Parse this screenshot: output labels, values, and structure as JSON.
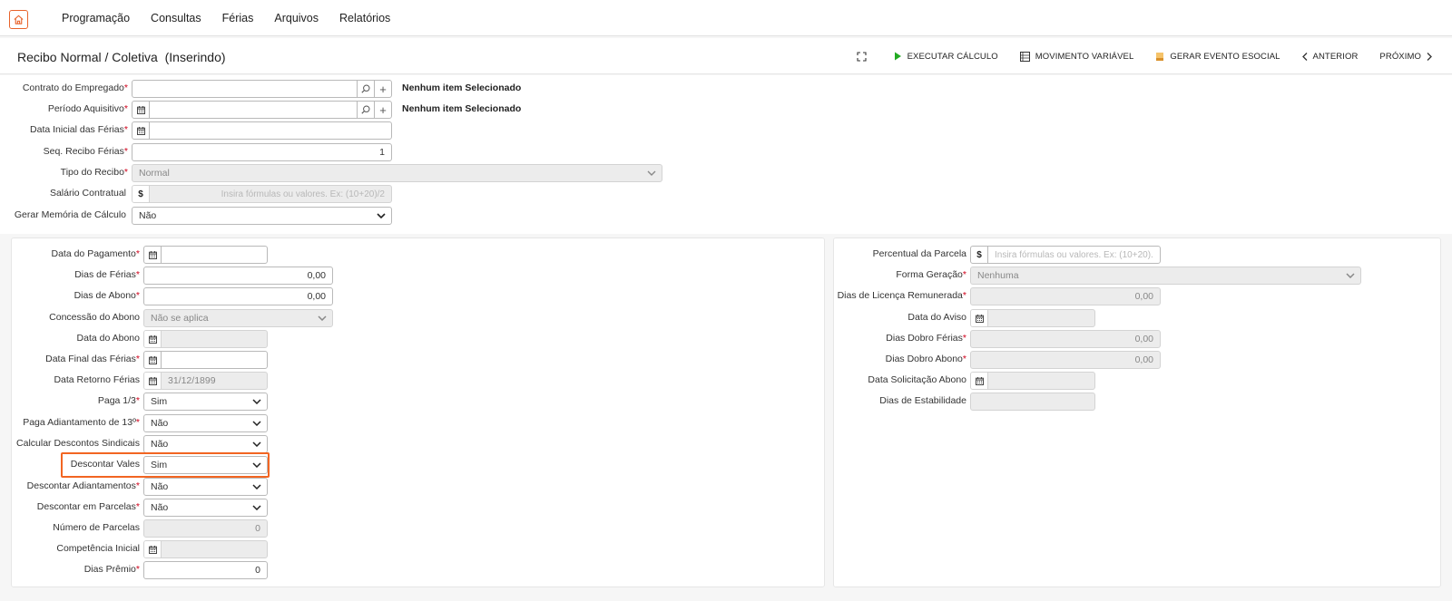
{
  "nav": {
    "home_icon": "home-icon",
    "items": [
      "Programação",
      "Consultas",
      "Férias",
      "Arquivos",
      "Relatórios"
    ]
  },
  "header": {
    "title": "Recibo Normal / Coletiva  (Inserindo)",
    "toolbar": {
      "execute": "EXECUTAR CÁLCULO",
      "movement": "MOVIMENTO VARIÁVEL",
      "esocial": "GERAR EVENTO ESOCIAL",
      "previous": "ANTERIOR",
      "next": "PRÓXIMO"
    }
  },
  "top_form": {
    "contrato": {
      "label": "Contrato do Empregado",
      "value": "",
      "info": "Nenhum item Selecionado"
    },
    "periodo": {
      "label": "Período Aquisitivo",
      "value": "",
      "info": "Nenhum item Selecionado"
    },
    "data_inicial": {
      "label": "Data Inicial das Férias",
      "value": ""
    },
    "seq_recibo": {
      "label": "Seq. Recibo Férias",
      "value": "1"
    },
    "tipo_recibo": {
      "label": "Tipo do Recibo",
      "value": "Normal"
    },
    "salario": {
      "label": "Salário Contratual",
      "placeholder": "Insira fórmulas ou valores. Ex: (10+20)/2"
    },
    "memoria": {
      "label": "Gerar Memória de Cálculo",
      "value": "Não"
    }
  },
  "left_panel": {
    "data_pagamento": {
      "label": "Data do Pagamento",
      "value": ""
    },
    "dias_ferias": {
      "label": "Dias de Férias",
      "value": "0,00"
    },
    "dias_abono": {
      "label": "Dias de Abono",
      "value": "0,00"
    },
    "concessao_abono": {
      "label": "Concessão do Abono",
      "value": "Não se aplica"
    },
    "data_abono": {
      "label": "Data do Abono",
      "value": ""
    },
    "data_final": {
      "label": "Data Final das Férias",
      "value": ""
    },
    "data_retorno": {
      "label": "Data Retorno Férias",
      "value": "31/12/1899"
    },
    "paga_terco": {
      "label": "Paga 1/3",
      "value": "Sim"
    },
    "paga_adiant": {
      "label": "Paga Adiantamento de 13º",
      "value": "Não"
    },
    "calc_sindicais": {
      "label": "Calcular Descontos Sindicais",
      "value": "Não"
    },
    "descontar_vales": {
      "label": "Descontar Vales",
      "value": "Sim"
    },
    "descontar_adiant": {
      "label": "Descontar Adiantamentos",
      "value": "Não"
    },
    "descontar_parcelas": {
      "label": "Descontar em Parcelas",
      "value": "Não"
    },
    "numero_parcelas": {
      "label": "Número de Parcelas",
      "value": "0"
    },
    "competencia": {
      "label": "Competência Inicial",
      "value": ""
    },
    "dias_premio": {
      "label": "Dias Prêmio",
      "value": "0"
    }
  },
  "right_panel": {
    "percentual": {
      "label": "Percentual da Parcela",
      "placeholder": "Insira fórmulas ou valores. Ex: (10+20)."
    },
    "forma_geracao": {
      "label": "Forma Geração",
      "value": "Nenhuma"
    },
    "dias_licenca": {
      "label": "Dias de Licença Remunerada",
      "value": "0,00"
    },
    "data_aviso": {
      "label": "Data do Aviso",
      "value": ""
    },
    "dobro_ferias": {
      "label": "Dias Dobro Férias",
      "value": "0,00"
    },
    "dobro_abono": {
      "label": "Dias Dobro Abono",
      "value": "0,00"
    },
    "data_solic": {
      "label": "Data Solicitação Abono",
      "value": ""
    },
    "estabilidade": {
      "label": "Dias de Estabilidade",
      "value": ""
    }
  },
  "colors": {
    "accent": "#f26522",
    "required": "#d0021b",
    "play": "#22aa22"
  }
}
